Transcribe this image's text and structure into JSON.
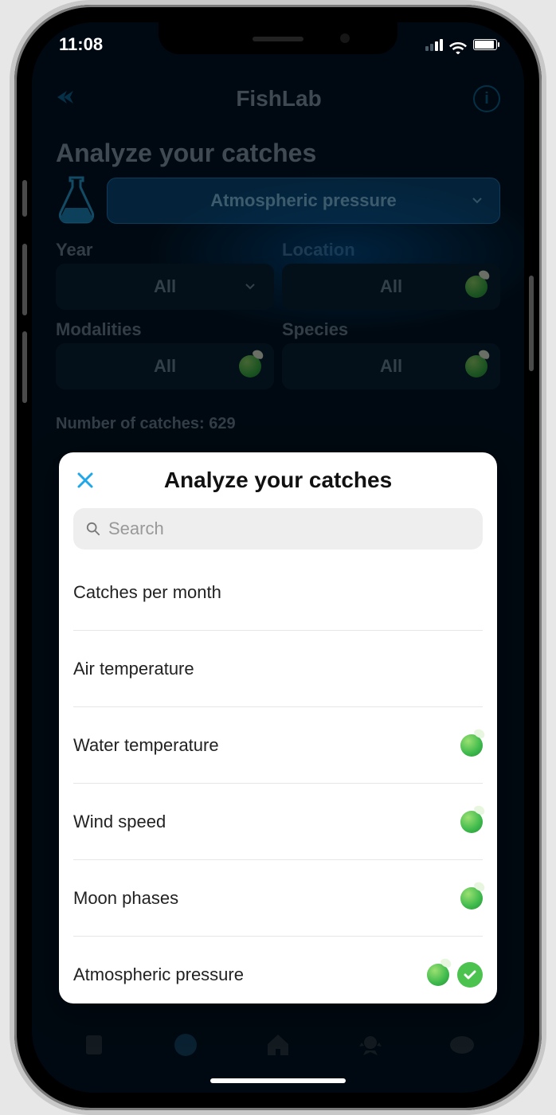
{
  "status": {
    "time": "11:08"
  },
  "nav": {
    "title": "FishLab"
  },
  "page": {
    "title": "Analyze your catches"
  },
  "main_select": {
    "label": "Atmospheric pressure"
  },
  "filters": {
    "year": {
      "label": "Year",
      "value": "All"
    },
    "location": {
      "label": "Location",
      "value": "All"
    },
    "modal": {
      "label": "Modalities",
      "value": "All"
    },
    "species": {
      "label": "Species",
      "value": "All"
    }
  },
  "catches": {
    "label": "Number of catches: ",
    "value": "629"
  },
  "modal": {
    "title": "Analyze your catches",
    "search_placeholder": "Search",
    "options": [
      {
        "label": "Catches per month",
        "badge": false,
        "selected": false
      },
      {
        "label": "Air temperature",
        "badge": false,
        "selected": false
      },
      {
        "label": "Water temperature",
        "badge": true,
        "selected": false
      },
      {
        "label": "Wind speed",
        "badge": true,
        "selected": false
      },
      {
        "label": "Moon phases",
        "badge": true,
        "selected": false
      },
      {
        "label": "Atmospheric pressure",
        "badge": true,
        "selected": true
      }
    ]
  }
}
